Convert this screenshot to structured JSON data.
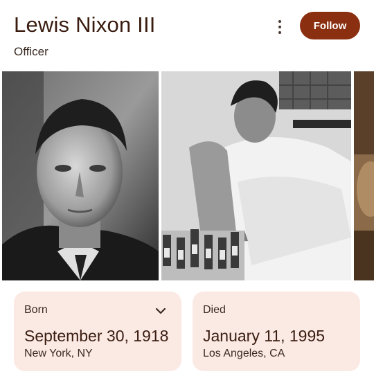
{
  "header": {
    "title": "Lewis Nixon III",
    "subtitle": "Officer",
    "follow_label": "Follow",
    "more_icon": "more-vertical-icon"
  },
  "colors": {
    "accent": "#8a2f0f",
    "card_background": "#fbeae4",
    "title_text": "#3a1c10"
  },
  "gallery": {
    "photos": [
      {
        "name": "portrait-photo",
        "tone": "black-and-white"
      },
      {
        "name": "bed-scene-photo",
        "tone": "black-and-white"
      },
      {
        "name": "partial-photo",
        "tone": "sepia"
      }
    ]
  },
  "facts": {
    "born": {
      "label": "Born",
      "date": "September 30, 1918",
      "place": "New York, NY",
      "icon": "chevron-down-icon"
    },
    "died": {
      "label": "Died",
      "date": "January 11, 1995",
      "place": "Los Angeles, CA"
    }
  }
}
